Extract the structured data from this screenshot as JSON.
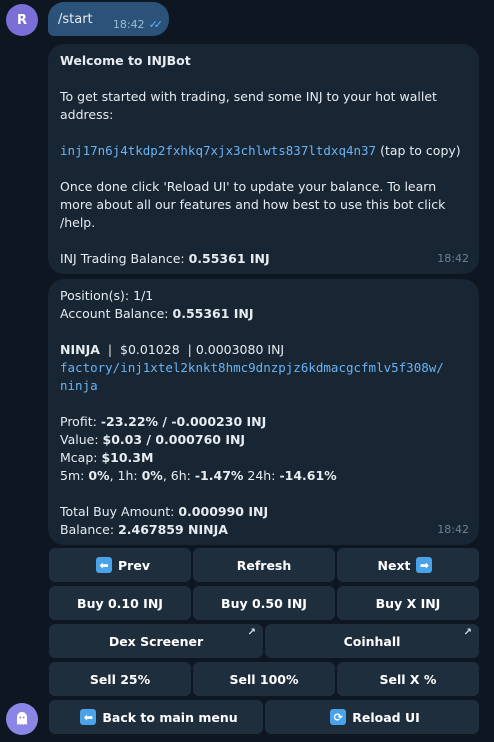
{
  "user": {
    "avatar_letter": "R",
    "command": "/start",
    "time": "18:42"
  },
  "welcome": {
    "title": "Welcome to INJBot",
    "intro": "To get started with trading, send some INJ to your hot wallet address:",
    "address": "inj17n6j4tkdp2fxhkq7xjx3chlwts837ltdxq4n37",
    "address_suffix": "(tap to copy)",
    "instructions": "Once done click 'Reload UI' to update your balance. To learn more about all our features and how best to use this bot click /help.",
    "balance_label": "INJ Trading Balance:",
    "balance_value": "0.55361 INJ",
    "time": "18:42"
  },
  "position": {
    "positions_label": "Position(s):",
    "positions_value": "1/1",
    "account_label": "Account Balance:",
    "account_value": "0.55361 INJ",
    "token": "NINJA",
    "token_price": "$0.01028",
    "token_inj": "0.0003080 INJ",
    "denom_line1": "factory/inj1xtel2knkt8hmc9dnzpjz6kdmacgcfmlv5f308w/",
    "denom_line2": "ninja",
    "profit_label": "Profit:",
    "profit_value": "-23.22% / -0.000230 INJ",
    "value_label": "Value:",
    "value_value": "$0.03 / 0.000760 INJ",
    "mcap_label": "Mcap:",
    "mcap_value": "$10.3M",
    "change_5m_label": "5m:",
    "change_5m": "0%",
    "change_1h_label": "1h:",
    "change_1h": "0%",
    "change_6h_label": "6h:",
    "change_6h": "-1.47%",
    "change_24h_label": "24h:",
    "change_24h": "-14.61%",
    "total_buy_label": "Total Buy Amount:",
    "total_buy_value": "0.000990 INJ",
    "balance_label": "Balance:",
    "balance_value": "2.467859 NINJA",
    "time": "18:42"
  },
  "buttons": {
    "prev": "Prev",
    "refresh": "Refresh",
    "next": "Next",
    "buy_010": "Buy 0.10 INJ",
    "buy_050": "Buy 0.50 INJ",
    "buy_x": "Buy X INJ",
    "dex_screener": "Dex Screener",
    "coinhall": "Coinhall",
    "sell_25": "Sell 25%",
    "sell_100": "Sell 100%",
    "sell_x": "Sell X %",
    "back": "Back to main menu",
    "reload": "Reload UI"
  },
  "icons": {
    "prev": "arrow-left-icon",
    "next": "arrow-right-icon",
    "back": "arrow-left-icon",
    "reload": "reload-icon",
    "external": "external-link-icon",
    "bot_avatar": "ghost-icon"
  },
  "colors": {
    "background": "#0e1621",
    "bubble": "#182533",
    "outgoing": "#2b5278",
    "link": "#6ab3f3",
    "button": "#1f2e3d"
  }
}
